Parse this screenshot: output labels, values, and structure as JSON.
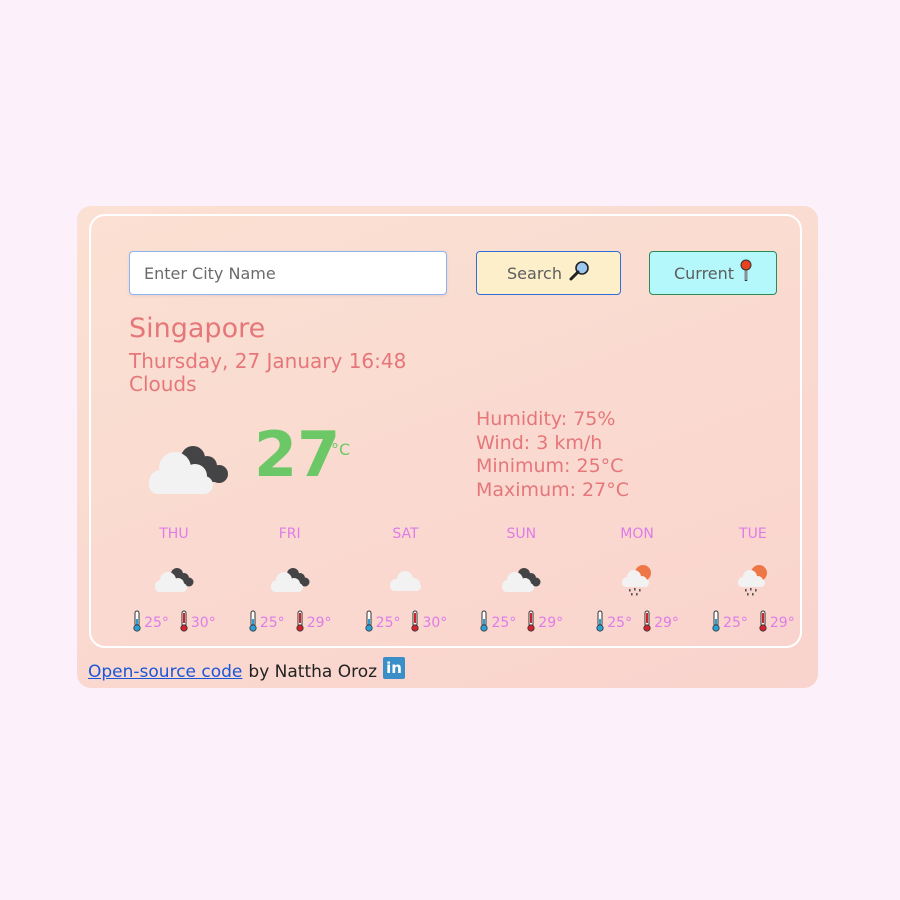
{
  "search": {
    "placeholder": "Enter City Name",
    "value": "",
    "search_label": "Search",
    "search_icon": "magnifying-glass-icon",
    "current_label": "Current",
    "current_icon": "pushpin-icon"
  },
  "weather": {
    "city": "Singapore",
    "datetime": "Thursday, 27 January 16:48",
    "description": "Clouds",
    "icon": "cloudy-icon",
    "temperature": "27",
    "unit": "°C",
    "humidity": "Humidity: 75%",
    "wind": "Wind: 3 km/h",
    "minimum": "Minimum: 25°C",
    "maximum": "Maximum: 27°C"
  },
  "forecast": [
    {
      "day": "THU",
      "icon": "broken-clouds-icon",
      "min": "25°",
      "max": "30°"
    },
    {
      "day": "FRI",
      "icon": "broken-clouds-icon",
      "min": "25°",
      "max": "29°"
    },
    {
      "day": "SAT",
      "icon": "cloud-icon",
      "min": "25°",
      "max": "30°"
    },
    {
      "day": "SUN",
      "icon": "broken-clouds-icon",
      "min": "25°",
      "max": "29°"
    },
    {
      "day": "MON",
      "icon": "rain-sun-icon",
      "min": "25°",
      "max": "29°"
    },
    {
      "day": "TUE",
      "icon": "rain-sun-icon",
      "min": "25°",
      "max": "29°"
    }
  ],
  "footer": {
    "link_text": "Open-source code ",
    "author_text": "by Nattha Oroz",
    "social_icon": "linkedin-icon",
    "social_text": "in"
  },
  "colors": {
    "accent_text": "#e5777a",
    "temperature": "#6cc866",
    "forecast_text": "#df7ce8",
    "page_bg": "#fcf0fa"
  }
}
